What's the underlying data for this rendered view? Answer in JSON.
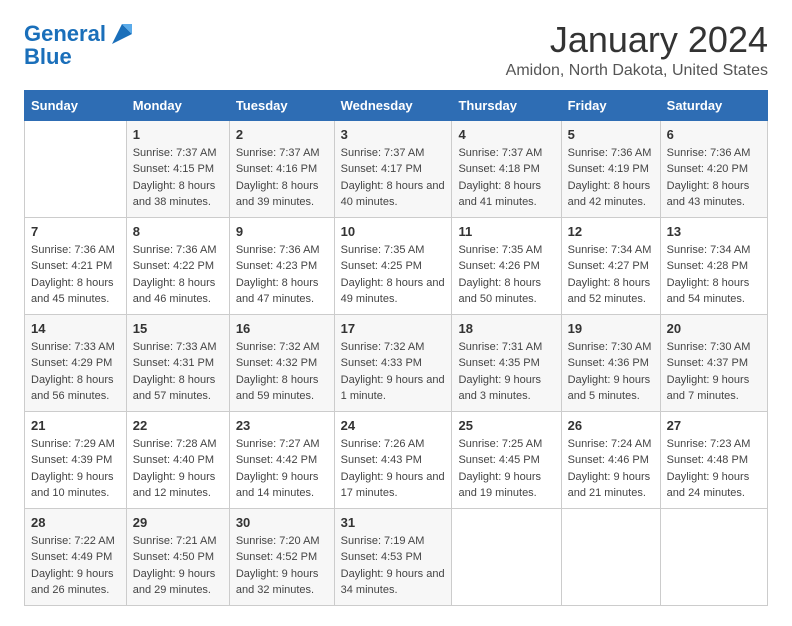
{
  "logo": {
    "line1": "General",
    "line2": "Blue"
  },
  "title": "January 2024",
  "subtitle": "Amidon, North Dakota, United States",
  "days_of_week": [
    "Sunday",
    "Monday",
    "Tuesday",
    "Wednesday",
    "Thursday",
    "Friday",
    "Saturday"
  ],
  "weeks": [
    [
      {
        "day": "",
        "sunrise": "",
        "sunset": "",
        "daylight": ""
      },
      {
        "day": "1",
        "sunrise": "Sunrise: 7:37 AM",
        "sunset": "Sunset: 4:15 PM",
        "daylight": "Daylight: 8 hours and 38 minutes."
      },
      {
        "day": "2",
        "sunrise": "Sunrise: 7:37 AM",
        "sunset": "Sunset: 4:16 PM",
        "daylight": "Daylight: 8 hours and 39 minutes."
      },
      {
        "day": "3",
        "sunrise": "Sunrise: 7:37 AM",
        "sunset": "Sunset: 4:17 PM",
        "daylight": "Daylight: 8 hours and 40 minutes."
      },
      {
        "day": "4",
        "sunrise": "Sunrise: 7:37 AM",
        "sunset": "Sunset: 4:18 PM",
        "daylight": "Daylight: 8 hours and 41 minutes."
      },
      {
        "day": "5",
        "sunrise": "Sunrise: 7:36 AM",
        "sunset": "Sunset: 4:19 PM",
        "daylight": "Daylight: 8 hours and 42 minutes."
      },
      {
        "day": "6",
        "sunrise": "Sunrise: 7:36 AM",
        "sunset": "Sunset: 4:20 PM",
        "daylight": "Daylight: 8 hours and 43 minutes."
      }
    ],
    [
      {
        "day": "7",
        "sunrise": "Sunrise: 7:36 AM",
        "sunset": "Sunset: 4:21 PM",
        "daylight": "Daylight: 8 hours and 45 minutes."
      },
      {
        "day": "8",
        "sunrise": "Sunrise: 7:36 AM",
        "sunset": "Sunset: 4:22 PM",
        "daylight": "Daylight: 8 hours and 46 minutes."
      },
      {
        "day": "9",
        "sunrise": "Sunrise: 7:36 AM",
        "sunset": "Sunset: 4:23 PM",
        "daylight": "Daylight: 8 hours and 47 minutes."
      },
      {
        "day": "10",
        "sunrise": "Sunrise: 7:35 AM",
        "sunset": "Sunset: 4:25 PM",
        "daylight": "Daylight: 8 hours and 49 minutes."
      },
      {
        "day": "11",
        "sunrise": "Sunrise: 7:35 AM",
        "sunset": "Sunset: 4:26 PM",
        "daylight": "Daylight: 8 hours and 50 minutes."
      },
      {
        "day": "12",
        "sunrise": "Sunrise: 7:34 AM",
        "sunset": "Sunset: 4:27 PM",
        "daylight": "Daylight: 8 hours and 52 minutes."
      },
      {
        "day": "13",
        "sunrise": "Sunrise: 7:34 AM",
        "sunset": "Sunset: 4:28 PM",
        "daylight": "Daylight: 8 hours and 54 minutes."
      }
    ],
    [
      {
        "day": "14",
        "sunrise": "Sunrise: 7:33 AM",
        "sunset": "Sunset: 4:29 PM",
        "daylight": "Daylight: 8 hours and 56 minutes."
      },
      {
        "day": "15",
        "sunrise": "Sunrise: 7:33 AM",
        "sunset": "Sunset: 4:31 PM",
        "daylight": "Daylight: 8 hours and 57 minutes."
      },
      {
        "day": "16",
        "sunrise": "Sunrise: 7:32 AM",
        "sunset": "Sunset: 4:32 PM",
        "daylight": "Daylight: 8 hours and 59 minutes."
      },
      {
        "day": "17",
        "sunrise": "Sunrise: 7:32 AM",
        "sunset": "Sunset: 4:33 PM",
        "daylight": "Daylight: 9 hours and 1 minute."
      },
      {
        "day": "18",
        "sunrise": "Sunrise: 7:31 AM",
        "sunset": "Sunset: 4:35 PM",
        "daylight": "Daylight: 9 hours and 3 minutes."
      },
      {
        "day": "19",
        "sunrise": "Sunrise: 7:30 AM",
        "sunset": "Sunset: 4:36 PM",
        "daylight": "Daylight: 9 hours and 5 minutes."
      },
      {
        "day": "20",
        "sunrise": "Sunrise: 7:30 AM",
        "sunset": "Sunset: 4:37 PM",
        "daylight": "Daylight: 9 hours and 7 minutes."
      }
    ],
    [
      {
        "day": "21",
        "sunrise": "Sunrise: 7:29 AM",
        "sunset": "Sunset: 4:39 PM",
        "daylight": "Daylight: 9 hours and 10 minutes."
      },
      {
        "day": "22",
        "sunrise": "Sunrise: 7:28 AM",
        "sunset": "Sunset: 4:40 PM",
        "daylight": "Daylight: 9 hours and 12 minutes."
      },
      {
        "day": "23",
        "sunrise": "Sunrise: 7:27 AM",
        "sunset": "Sunset: 4:42 PM",
        "daylight": "Daylight: 9 hours and 14 minutes."
      },
      {
        "day": "24",
        "sunrise": "Sunrise: 7:26 AM",
        "sunset": "Sunset: 4:43 PM",
        "daylight": "Daylight: 9 hours and 17 minutes."
      },
      {
        "day": "25",
        "sunrise": "Sunrise: 7:25 AM",
        "sunset": "Sunset: 4:45 PM",
        "daylight": "Daylight: 9 hours and 19 minutes."
      },
      {
        "day": "26",
        "sunrise": "Sunrise: 7:24 AM",
        "sunset": "Sunset: 4:46 PM",
        "daylight": "Daylight: 9 hours and 21 minutes."
      },
      {
        "day": "27",
        "sunrise": "Sunrise: 7:23 AM",
        "sunset": "Sunset: 4:48 PM",
        "daylight": "Daylight: 9 hours and 24 minutes."
      }
    ],
    [
      {
        "day": "28",
        "sunrise": "Sunrise: 7:22 AM",
        "sunset": "Sunset: 4:49 PM",
        "daylight": "Daylight: 9 hours and 26 minutes."
      },
      {
        "day": "29",
        "sunrise": "Sunrise: 7:21 AM",
        "sunset": "Sunset: 4:50 PM",
        "daylight": "Daylight: 9 hours and 29 minutes."
      },
      {
        "day": "30",
        "sunrise": "Sunrise: 7:20 AM",
        "sunset": "Sunset: 4:52 PM",
        "daylight": "Daylight: 9 hours and 32 minutes."
      },
      {
        "day": "31",
        "sunrise": "Sunrise: 7:19 AM",
        "sunset": "Sunset: 4:53 PM",
        "daylight": "Daylight: 9 hours and 34 minutes."
      },
      {
        "day": "",
        "sunrise": "",
        "sunset": "",
        "daylight": ""
      },
      {
        "day": "",
        "sunrise": "",
        "sunset": "",
        "daylight": ""
      },
      {
        "day": "",
        "sunrise": "",
        "sunset": "",
        "daylight": ""
      }
    ]
  ]
}
